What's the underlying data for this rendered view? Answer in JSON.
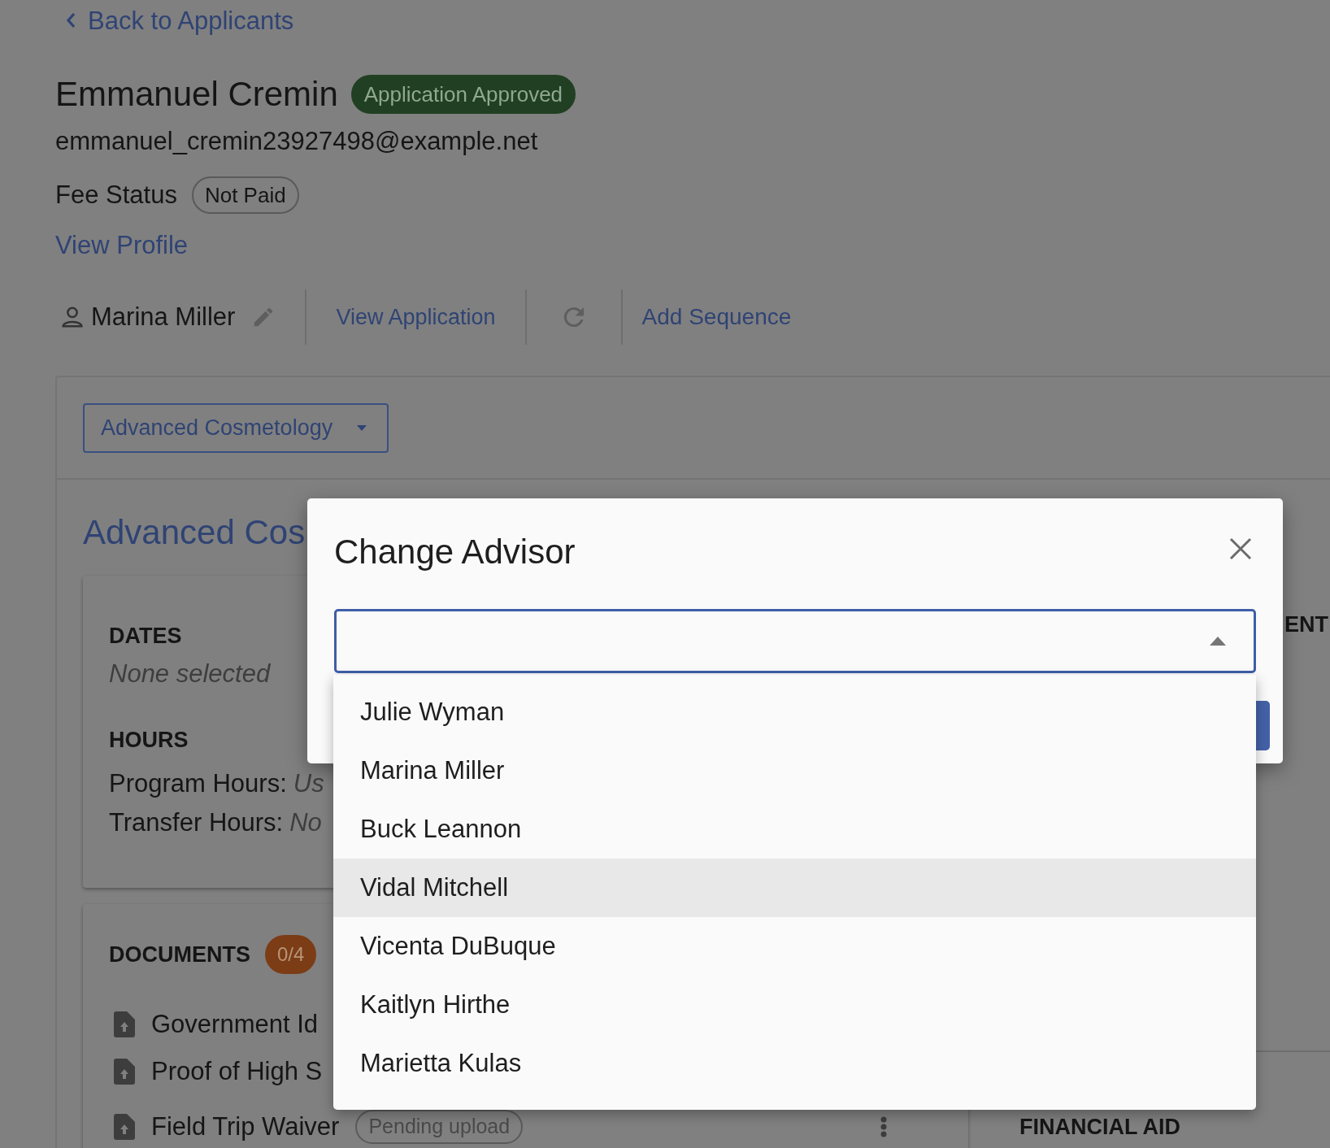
{
  "back_link": "Back to Applicants",
  "applicant": {
    "name": "Emmanuel Cremin",
    "status": "Application Approved",
    "email": "emmanuel_cremin23927498@example.net",
    "fee_label": "Fee Status",
    "fee_status": "Not Paid",
    "profile_link": "View Profile"
  },
  "toolbar": {
    "advisor": "Marina Miller",
    "view_application": "View Application",
    "add_sequence": "Add Sequence"
  },
  "program_select": "Advanced Cosmetology",
  "program_title": "Advanced Cos",
  "dates": {
    "heading": "DATES",
    "value": "None selected"
  },
  "hours": {
    "heading": "HOURS",
    "rows": [
      {
        "label": "Program Hours:",
        "value": "Us"
      },
      {
        "label": "Transfer Hours:",
        "value": "No"
      }
    ]
  },
  "documents": {
    "heading": "DOCUMENTS",
    "count": "0/4",
    "items": [
      {
        "name": "Government Id"
      },
      {
        "name": "Proof of High S"
      },
      {
        "name": "Field Trip Waiver",
        "badge": "Pending upload"
      }
    ]
  },
  "side_heading": "ENT",
  "financial_aid_heading": "FINANCIAL AID",
  "modal": {
    "title": "Change Advisor",
    "options": [
      {
        "label": "Julie Wyman",
        "selected": false
      },
      {
        "label": "Marina Miller",
        "selected": false
      },
      {
        "label": "Buck Leannon",
        "selected": false
      },
      {
        "label": "Vidal Mitchell",
        "selected": true
      },
      {
        "label": "Vicenta DuBuque",
        "selected": false
      },
      {
        "label": "Kaitlyn Hirthe",
        "selected": false
      },
      {
        "label": "Marietta Kulas",
        "selected": false
      }
    ]
  }
}
